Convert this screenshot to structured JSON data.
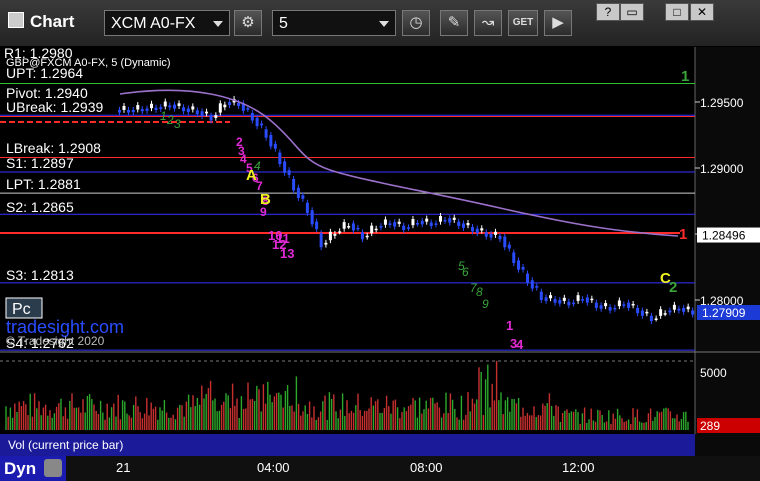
{
  "window": {
    "title": "Chart",
    "help": "?",
    "restore": "▭",
    "maximize": "□",
    "close": "✕"
  },
  "toolbar": {
    "symbol": "XCM A0-FX",
    "interval": "5"
  },
  "header": {
    "instrument": "GBP@FXCM A0-FX, 5 (Dynamic)",
    "r1_cut": "R1: 1.2980"
  },
  "levels": [
    {
      "label": "UPT: 1.2964",
      "value": 1.2964,
      "color": "#2fbf2f"
    },
    {
      "label": "Pivot: 1.2940",
      "value": 1.294,
      "color": "#2f2fff"
    },
    {
      "label": "UBreak: 1.2939",
      "value": 1.2939,
      "color": "#ff2b2b"
    },
    {
      "label": "LBreak: 1.2908",
      "value": 1.2908,
      "color": "#ff2b2b"
    },
    {
      "label": "S1: 1.2897",
      "value": 1.2897,
      "color": "#3333ff"
    },
    {
      "label": "LPT: 1.2881",
      "value": 1.2881,
      "color": "#cfcfcf"
    },
    {
      "label": "S2: 1.2865",
      "value": 1.2865,
      "color": "#3333ff"
    },
    {
      "label": "S3: 1.2813",
      "value": 1.2813,
      "color": "#3333ff"
    },
    {
      "label": "S4: 1.2762",
      "value": 1.2762,
      "color": "#3333ff"
    }
  ],
  "watermark": {
    "text": "tradesight.com",
    "copy": "© Tradesight 2020",
    "pc": "Pc"
  },
  "price_axis": {
    "ticks": [
      "1.29500",
      "1.29000",
      "1.28500",
      "1.28000"
    ],
    "tick_values": [
      1.295,
      1.29,
      1.285,
      1.28
    ],
    "marker_red": "1.28496",
    "marker_last": "1.27909"
  },
  "volume": {
    "label": "Vol (current price bar)",
    "axis_label": "5000",
    "current": "289"
  },
  "time_axis": {
    "labels": [
      "21",
      "04:00",
      "08:00",
      "12:00"
    ]
  },
  "annotations": {
    "counts_green": [
      "1",
      "2",
      "3",
      "4",
      "5",
      "6",
      "7",
      "8",
      "9"
    ],
    "counts_magenta": [
      "2",
      "3",
      "4",
      "5",
      "6",
      "7",
      "8",
      "9",
      "10",
      "11",
      "12",
      "13"
    ],
    "letters": [
      "A",
      "B",
      "C"
    ],
    "right_numbers": [
      "1",
      "1",
      "2"
    ]
  },
  "bottom": {
    "mode": "Dyn"
  },
  "chart_data": {
    "type": "candlestick",
    "title": "GBP@FXCM A0-FX, 5 (Dynamic)",
    "ylim": [
      1.2762,
      1.2985
    ],
    "series": [
      {
        "name": "Price",
        "close_path": [
          [
            0,
            1.2944
          ],
          [
            8,
            1.2945
          ],
          [
            16,
            1.2946
          ],
          [
            24,
            1.2948
          ],
          [
            32,
            1.2945
          ],
          [
            40,
            1.2943
          ],
          [
            48,
            1.2938
          ],
          [
            56,
            1.295
          ],
          [
            64,
            1.2949
          ],
          [
            72,
            1.2938
          ],
          [
            80,
            1.2925
          ],
          [
            88,
            1.2905
          ],
          [
            96,
            1.2885
          ],
          [
            104,
            1.2868
          ],
          [
            112,
            1.2842
          ],
          [
            120,
            1.2852
          ],
          [
            128,
            1.2858
          ],
          [
            136,
            1.2848
          ],
          [
            144,
            1.2856
          ],
          [
            152,
            1.2859
          ],
          [
            160,
            1.2855
          ],
          [
            168,
            1.286
          ],
          [
            176,
            1.2858
          ],
          [
            184,
            1.2862
          ],
          [
            192,
            1.2858
          ],
          [
            200,
            1.2854
          ],
          [
            208,
            1.285
          ],
          [
            216,
            1.2848
          ],
          [
            224,
            1.283
          ],
          [
            232,
            1.2815
          ],
          [
            240,
            1.2802
          ],
          [
            248,
            1.28
          ],
          [
            256,
            1.2798
          ],
          [
            264,
            1.2802
          ],
          [
            272,
            1.2796
          ],
          [
            280,
            1.2794
          ],
          [
            288,
            1.2798
          ],
          [
            296,
            1.2792
          ],
          [
            304,
            1.2786
          ],
          [
            312,
            1.2792
          ],
          [
            320,
            1.2794
          ],
          [
            328,
            1.2791
          ]
        ]
      }
    ]
  }
}
